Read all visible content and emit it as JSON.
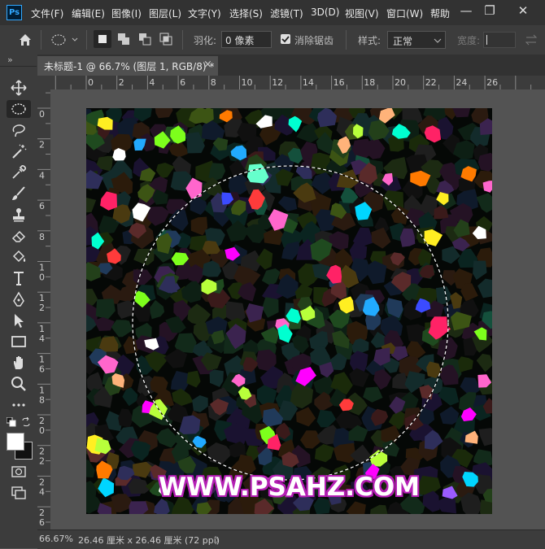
{
  "app": {
    "logo": "Ps"
  },
  "menu": [
    "文件(F)",
    "编辑(E)",
    "图像(I)",
    "图层(L)",
    "文字(Y)",
    "选择(S)",
    "滤镜(T)",
    "3D(D)",
    "视图(V)",
    "窗口(W)",
    "帮助"
  ],
  "window_controls": {
    "minimize": "—",
    "restore": "❐",
    "close": "✕"
  },
  "options": {
    "feather_label": "羽化:",
    "feather_value": "0 像素",
    "antialias_label": "消除锯齿",
    "antialias_checked": true,
    "style_label": "样式:",
    "style_value": "正常",
    "width_label": "宽度:"
  },
  "tab": {
    "title": "未标题-1 @ 66.7% (图层 1, RGB/8) *",
    "close": "×"
  },
  "ruler_top": [
    "0",
    "2",
    "4",
    "6",
    "8",
    "10",
    "12",
    "14",
    "16",
    "18",
    "20",
    "22",
    "24",
    "26"
  ],
  "ruler_left": [
    "0",
    "2",
    "4",
    "6",
    "8",
    "1\n0",
    "1\n2",
    "1\n4",
    "1\n6",
    "1\n8",
    "2\n0",
    "2\n2",
    "2\n4",
    "2\n6"
  ],
  "canvas": {
    "watermark": "WWW.PSAHZ.COM"
  },
  "status": {
    "zoom": "66.67%",
    "doc_info": "26.46 厘米 x 26.46 厘米 (72 ppi)",
    "arrow": "〉"
  },
  "toolbar_expander": "»",
  "colors": {
    "accent": "#31a8ff",
    "watermark_outline": "#b51fb5",
    "bg": "#535353",
    "panel": "#3c3c3c"
  }
}
